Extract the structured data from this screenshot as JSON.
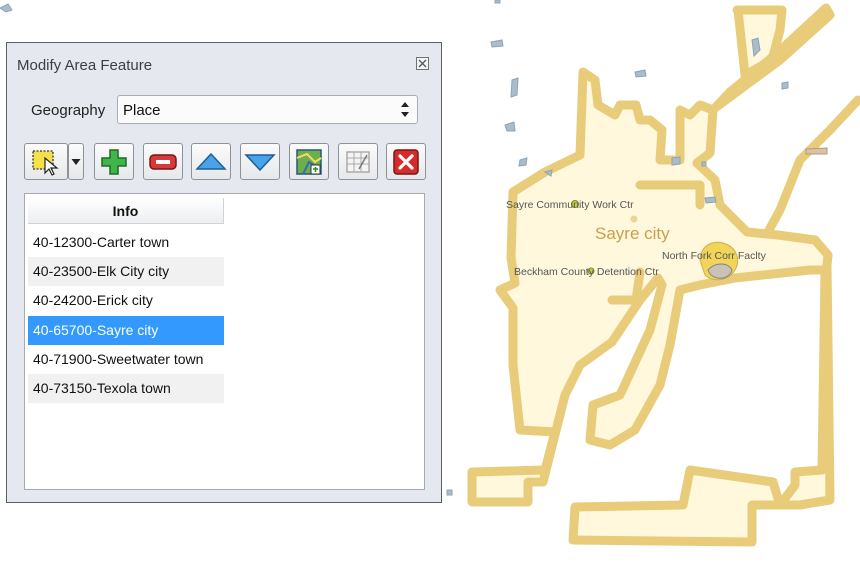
{
  "window": {
    "title": "Modify Area Feature"
  },
  "geography": {
    "label": "Geography",
    "value": "Place"
  },
  "toolbar": {
    "buttons": [
      {
        "icon": "select-feature-icon"
      },
      {
        "icon": "dropdown-arrow-icon"
      },
      {
        "icon": "add-icon"
      },
      {
        "icon": "remove-icon"
      },
      {
        "icon": "move-up-icon"
      },
      {
        "icon": "move-down-icon"
      },
      {
        "icon": "map-edit-icon"
      },
      {
        "icon": "attribute-table-icon"
      },
      {
        "icon": "delete-icon"
      }
    ]
  },
  "list": {
    "header": "Info",
    "rows": [
      {
        "label": "40-12300-Carter town",
        "selected": false
      },
      {
        "label": "40-23500-Elk City city",
        "selected": false
      },
      {
        "label": "40-24200-Erick city",
        "selected": false
      },
      {
        "label": "40-65700-Sayre city",
        "selected": true
      },
      {
        "label": "40-71900-Sweetwater town",
        "selected": false
      },
      {
        "label": "40-73150-Texola town",
        "selected": false
      }
    ]
  },
  "map": {
    "labels": {
      "place": "Sayre city",
      "poi_1": "Sayre Community Work Ctr",
      "poi_2": "Beckham County Detention Ctr",
      "poi_3": "North Fork Corr Faclty"
    },
    "colors": {
      "place_fill": "#fff8dc",
      "place_outline": "#e8cc7a",
      "water": "#a9bccb",
      "highlight": "#f2d45a"
    }
  }
}
